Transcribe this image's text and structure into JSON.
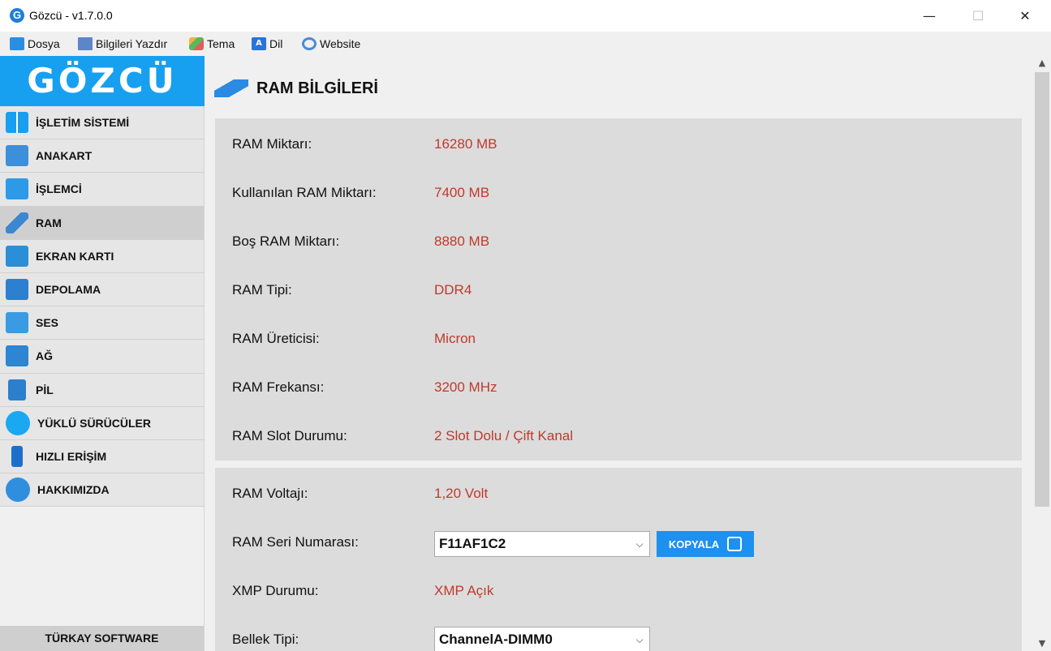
{
  "window": {
    "app_icon_letter": "G",
    "title": "Gözcü - v1.7.0.0",
    "minimize_glyph": "—",
    "maximize_glyph": "☐",
    "close_glyph": "✕"
  },
  "menu": {
    "items": [
      {
        "label": "Dosya",
        "icon": "folder-icon"
      },
      {
        "label": "Bilgileri Yazdır",
        "icon": "print-icon"
      },
      {
        "label": "Tema",
        "icon": "theme-icon"
      },
      {
        "label": "Dil",
        "icon": "language-icon",
        "icon_text": "A"
      },
      {
        "label": "Website",
        "icon": "link-icon"
      }
    ]
  },
  "sidebar": {
    "logo": "GÖZCÜ",
    "items": [
      {
        "label": "İŞLETİM SİSTEMİ",
        "icon": "windows-icon"
      },
      {
        "label": "ANAKART",
        "icon": "motherboard-icon"
      },
      {
        "label": "İŞLEMCİ",
        "icon": "cpu-icon"
      },
      {
        "label": "RAM",
        "icon": "ram-icon",
        "active": true
      },
      {
        "label": "EKRAN KARTI",
        "icon": "gpu-icon"
      },
      {
        "label": "DEPOLAMA",
        "icon": "storage-icon"
      },
      {
        "label": "SES",
        "icon": "speaker-icon"
      },
      {
        "label": "AĞ",
        "icon": "network-icon"
      },
      {
        "label": "PİL",
        "icon": "battery-icon"
      },
      {
        "label": "YÜKLÜ SÜRÜCÜLER",
        "icon": "driver-disc-icon"
      },
      {
        "label": "HIZLI ERİŞİM",
        "icon": "bookmark-icon"
      },
      {
        "label": "HAKKIMIZDA",
        "icon": "user-icon"
      }
    ],
    "footer": "TÜRKAY SOFTWARE"
  },
  "main": {
    "title": "RAM BİLGİLERİ",
    "panel1": [
      {
        "label": "RAM Miktarı:",
        "value": "16280 MB"
      },
      {
        "label": "Kullanılan RAM Miktarı:",
        "value": "7400 MB"
      },
      {
        "label": "Boş RAM Miktarı:",
        "value": "8880 MB"
      },
      {
        "label": "RAM Tipi:",
        "value": "DDR4"
      },
      {
        "label": "RAM Üreticisi:",
        "value": "Micron"
      },
      {
        "label": "RAM Frekansı:",
        "value": "3200 MHz"
      },
      {
        "label": "RAM Slot Durumu:",
        "value": "2 Slot Dolu / Çift Kanal"
      }
    ],
    "panel2": {
      "voltage": {
        "label": "RAM Voltajı:",
        "value": "1,20 Volt"
      },
      "serial": {
        "label": "RAM Seri Numarası:",
        "selected": "F11AF1C2",
        "copy_label": "KOPYALA"
      },
      "xmp": {
        "label": "XMP Durumu:",
        "value": "XMP Açık"
      },
      "memory_type": {
        "label": "Bellek Tipi:",
        "selected": "ChannelA-DIMM0"
      }
    },
    "combo_arrow": "⌵"
  },
  "scrollbar": {
    "up": "▲",
    "down": "▼",
    "thumb_position": 0.0
  },
  "colors": {
    "accent": "#17a0f0",
    "value_text": "#c0392b",
    "copy_button": "#1e90f0",
    "panel": "#dcdcdc"
  }
}
